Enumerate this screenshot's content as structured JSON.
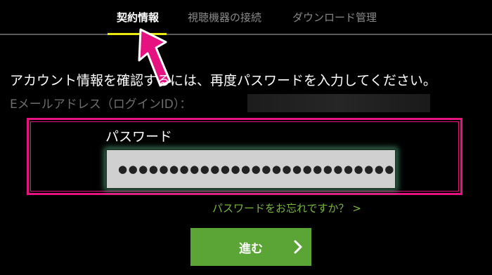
{
  "tabs": [
    {
      "label": "契約情報",
      "active": true
    },
    {
      "label": "視聴機器の接続",
      "active": false
    },
    {
      "label": "ダウンロード管理",
      "active": false
    }
  ],
  "instruction": "アカウント情報を確認するには、再度パスワードを入力してください。",
  "email": {
    "label": "Eメールアドレス（ログインID）："
  },
  "password": {
    "label": "パスワード",
    "value": "●●●●●●●●●●●●●●●●●●●●●●●●●●●"
  },
  "forgot_link": "パスワードをお忘れですか？ >",
  "proceed_button": "進む",
  "colors": {
    "accent_yellow": "#e8e812",
    "highlight_pink": "#e6127f",
    "button_green": "#5ba536",
    "link_green": "#79b83a",
    "pointer_pink": "#e6127f"
  },
  "icons": {
    "pointer": "arrow-pointer-icon",
    "proceed": "chevron-right-icon"
  }
}
